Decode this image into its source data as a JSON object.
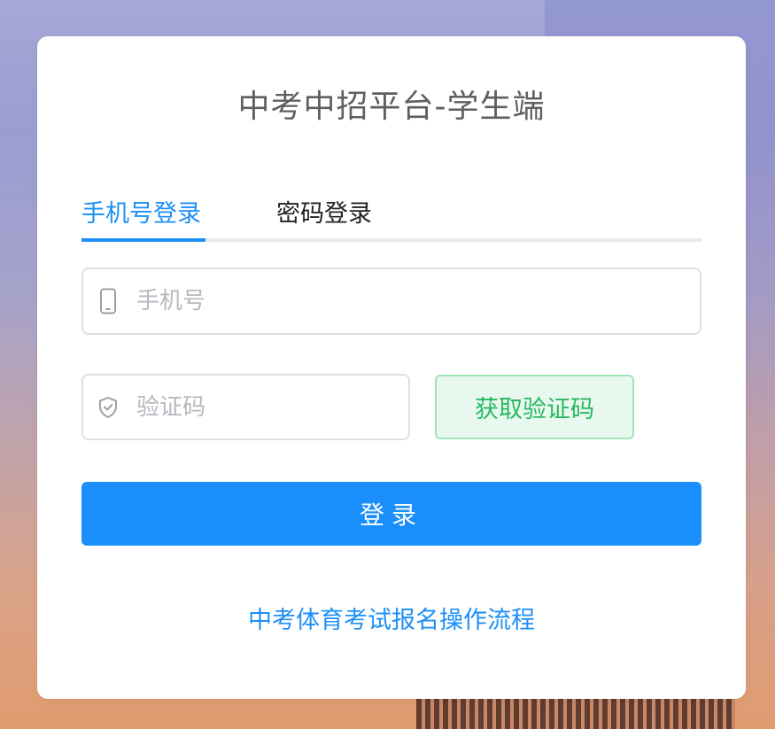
{
  "page": {
    "title": "中考中招平台-学生端"
  },
  "tabs": [
    {
      "label": "手机号登录",
      "active": true
    },
    {
      "label": "密码登录",
      "active": false
    }
  ],
  "phone_field": {
    "placeholder": "手机号",
    "value": "",
    "icon": "mobile-phone-icon"
  },
  "code_field": {
    "placeholder": "验证码",
    "value": "",
    "icon": "shield-check-icon"
  },
  "get_code_button": {
    "label": "获取验证码"
  },
  "login_button": {
    "label": "登录"
  },
  "process_link": {
    "label": "中考体育考试报名操作流程"
  },
  "colors": {
    "accent": "#1e8ff5",
    "primary_button": "#1a8ffb",
    "code_button_text": "#28b961",
    "code_button_bg": "#e9f8ef",
    "code_button_border": "#9fe3b8",
    "title": "#5f5f5f"
  }
}
